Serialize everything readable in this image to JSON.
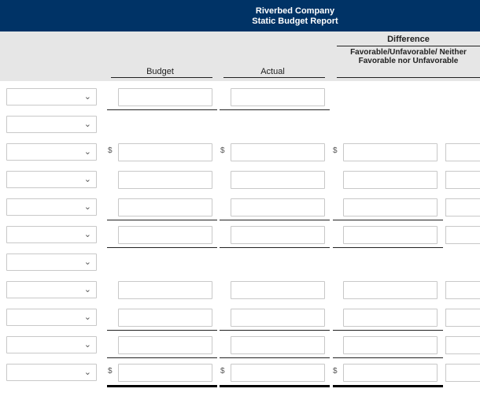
{
  "header": {
    "company": "Riverbed Company",
    "report_title": "Static Budget Report",
    "background_color": "#003366"
  },
  "columns": {
    "budget": "Budget",
    "actual": "Actual",
    "difference": "Difference",
    "difference_sub_line1": "Favorable/Unfavorable/",
    "difference_sub_line2": "Neither Favorable nor Unfavorable"
  },
  "currency_symbol": "$",
  "row_dropdown_icon": "chevron-down-icon"
}
